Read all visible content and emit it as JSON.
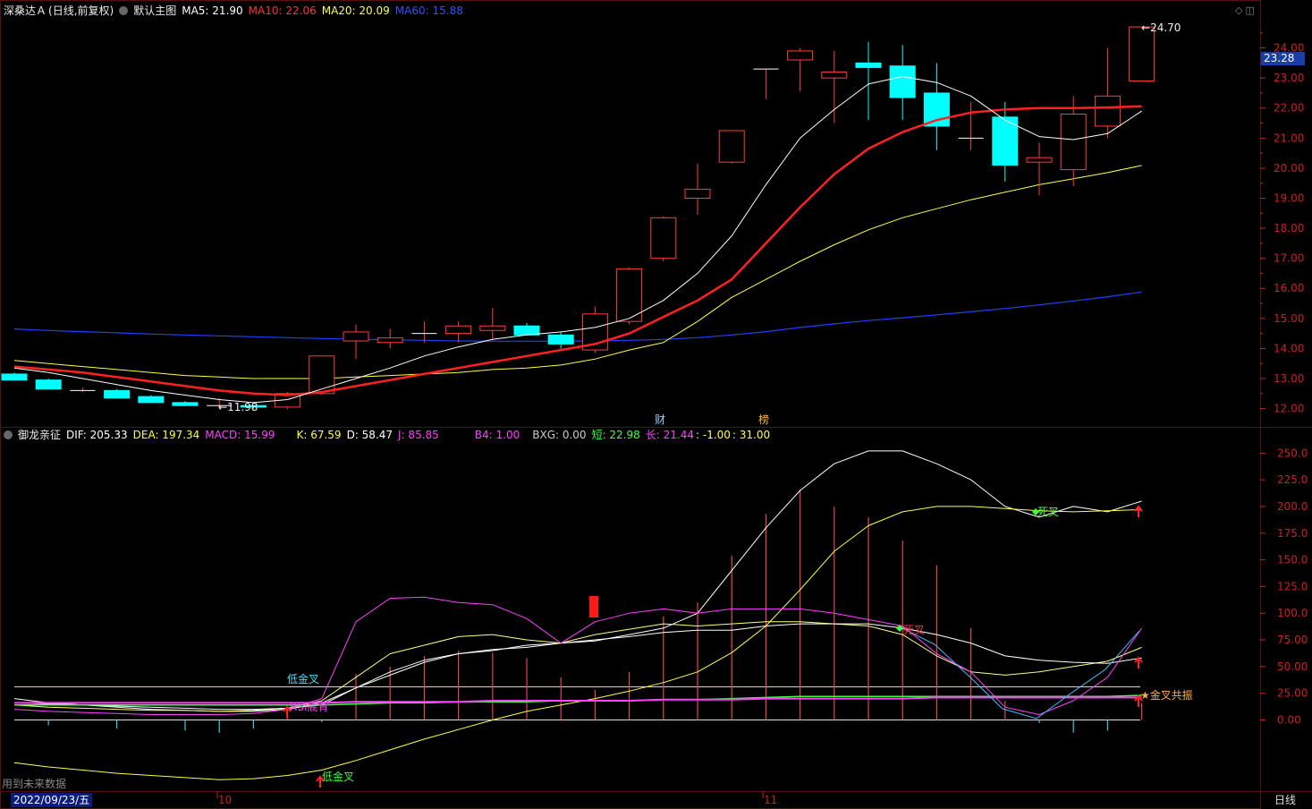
{
  "main_panel": {
    "stock_name": "深桑达Ａ",
    "mode": "(日线,前复权)",
    "indicator_name": "默认主图",
    "ma5": {
      "label": "MA5:",
      "value": "21.90",
      "color": "#ffffff"
    },
    "ma10": {
      "label": "MA10:",
      "value": "22.06",
      "color": "#ff3030"
    },
    "ma20": {
      "label": "MA20:",
      "value": "20.09",
      "color": "#ffff40"
    },
    "ma60": {
      "label": "MA60:",
      "value": "15.88",
      "color": "#3050ff"
    },
    "current_price_tag": "23.28",
    "high_annotation": "24.70",
    "low_annotation": "11.98",
    "event_marks": [
      "财",
      "榜"
    ]
  },
  "sub_panel": {
    "indicator_name": "御龙亲征",
    "readouts": [
      {
        "label": "DIF: 205.33",
        "color": "#ffffff"
      },
      {
        "label": "DEA: 197.34",
        "color": "#ffff40"
      },
      {
        "label": "MACD: 15.99",
        "color": "#ff40ff"
      },
      {
        "label": "K: 67.59",
        "color": "#ffff40"
      },
      {
        "label": "D: 58.47",
        "color": "#ffffff"
      },
      {
        "label": "J: 85.85",
        "color": "#ff40ff"
      },
      {
        "label": "B4: 1.00",
        "color": "#ff40ff"
      },
      {
        "label": "BXG: 0.00",
        "color": "#cccccc"
      },
      {
        "label": "短: 22.98",
        "color": "#40ff40"
      },
      {
        "label": "长: 21.44",
        "color": "#ff40ff"
      },
      {
        "label": ": -1.00",
        "color": "#ffff40"
      },
      {
        "label": ": 31.00",
        "color": "#ffff40"
      }
    ],
    "annotations": {
      "low_golden_cross_1": "低金叉",
      "rsi_label": "RSI底背",
      "low_golden_cross_2": "低金叉",
      "dead_cross_1": "死叉",
      "dead_cross_2": "死叉",
      "golden_cross_resonance": "金叉共振"
    }
  },
  "bottom_bar": {
    "date_box": "2022/09/23/五",
    "future_data_label": "用到未来数据",
    "month_labels": [
      "10",
      "11"
    ],
    "period_button": "日线"
  },
  "colors": {
    "up": "#ff3c3c",
    "down": "#00ffff",
    "ma5": "#ffffff",
    "ma10": "#ff2020",
    "ma20": "#ffff40",
    "ma60": "#2040ff",
    "grid": "#551111",
    "axis_text": "#cc2020"
  },
  "chart_data": [
    {
      "type": "candlestick",
      "title": "深桑达Ａ (日线,前复权)",
      "ylim": [
        11.6,
        25.0
      ],
      "y_ticks": [
        12.0,
        13.0,
        14.0,
        15.0,
        16.0,
        17.0,
        18.0,
        19.0,
        20.0,
        21.0,
        22.0,
        23.0,
        24.0
      ],
      "y_tick_labels": [
        "12.00",
        "13.00",
        "14.00",
        "15.00",
        "16.00",
        "17.00",
        "18.00",
        "19.00",
        "20.00",
        "21.00",
        "22.00",
        "23.00",
        "24.00"
      ],
      "ohlc": [
        [
          13.15,
          13.2,
          12.95,
          12.95
        ],
        [
          12.95,
          13.0,
          12.65,
          12.65
        ],
        [
          12.6,
          12.7,
          12.55,
          12.6
        ],
        [
          12.6,
          12.65,
          12.35,
          12.35
        ],
        [
          12.4,
          12.45,
          12.2,
          12.2
        ],
        [
          12.2,
          12.25,
          12.1,
          12.1
        ],
        [
          12.1,
          12.35,
          11.98,
          12.1
        ],
        [
          12.1,
          12.1,
          12.0,
          12.05
        ],
        [
          12.05,
          12.55,
          11.98,
          12.5
        ],
        [
          12.5,
          13.75,
          12.45,
          13.75
        ],
        [
          14.25,
          14.8,
          13.65,
          14.55
        ],
        [
          14.2,
          14.65,
          14.0,
          14.35
        ],
        [
          14.5,
          14.9,
          14.2,
          14.5
        ],
        [
          14.5,
          14.9,
          14.2,
          14.75
        ],
        [
          14.6,
          15.35,
          14.3,
          14.75
        ],
        [
          14.75,
          14.85,
          14.45,
          14.45
        ],
        [
          14.45,
          14.55,
          14.0,
          14.15
        ],
        [
          13.95,
          15.4,
          13.85,
          15.15
        ],
        [
          14.9,
          16.7,
          14.8,
          16.65
        ],
        [
          17.0,
          18.4,
          16.9,
          18.35
        ],
        [
          19.0,
          20.15,
          18.45,
          19.3
        ],
        [
          20.2,
          21.25,
          20.15,
          21.25
        ],
        [
          23.3,
          23.3,
          22.3,
          23.3
        ],
        [
          23.6,
          24.0,
          22.55,
          23.9
        ],
        [
          23.0,
          23.9,
          21.5,
          23.2
        ],
        [
          23.5,
          24.2,
          21.6,
          23.35
        ],
        [
          23.4,
          24.1,
          21.6,
          22.35
        ],
        [
          22.5,
          23.5,
          20.6,
          21.4
        ],
        [
          21.0,
          22.2,
          20.6,
          21.0
        ],
        [
          21.7,
          22.2,
          19.55,
          20.1
        ],
        [
          20.2,
          20.85,
          19.1,
          20.35
        ],
        [
          19.95,
          22.4,
          19.4,
          21.8
        ],
        [
          21.4,
          24.0,
          21.0,
          22.4
        ],
        [
          22.9,
          24.7,
          22.9,
          24.7
        ]
      ],
      "series": [
        {
          "name": "MA5",
          "values": [
            13.35,
            13.2,
            13.0,
            12.8,
            12.6,
            12.45,
            12.3,
            12.2,
            12.3,
            12.65,
            13.0,
            13.35,
            13.75,
            14.05,
            14.3,
            14.45,
            14.55,
            14.7,
            15.0,
            15.6,
            16.5,
            17.75,
            19.45,
            21.0,
            21.95,
            22.8,
            23.05,
            22.85,
            22.4,
            21.6,
            21.05,
            20.95,
            21.15,
            21.9
          ]
        },
        {
          "name": "MA10",
          "values": [
            13.4,
            13.3,
            13.2,
            13.05,
            12.9,
            12.75,
            12.6,
            12.5,
            12.45,
            12.55,
            12.75,
            12.95,
            13.15,
            13.35,
            13.55,
            13.75,
            13.95,
            14.15,
            14.5,
            15.05,
            15.6,
            16.3,
            17.5,
            18.7,
            19.8,
            20.65,
            21.2,
            21.6,
            21.85,
            21.95,
            22.0,
            22.0,
            22.02,
            22.06
          ]
        },
        {
          "name": "MA20",
          "values": [
            13.6,
            13.5,
            13.4,
            13.3,
            13.2,
            13.1,
            13.05,
            13.0,
            13.0,
            13.0,
            13.05,
            13.1,
            13.15,
            13.2,
            13.3,
            13.35,
            13.45,
            13.65,
            13.95,
            14.2,
            14.9,
            15.7,
            16.3,
            16.9,
            17.45,
            17.95,
            18.35,
            18.65,
            18.95,
            19.2,
            19.45,
            19.65,
            19.85,
            20.09
          ]
        },
        {
          "name": "MA60",
          "values": [
            14.65,
            14.6,
            14.56,
            14.52,
            14.48,
            14.45,
            14.42,
            14.39,
            14.36,
            14.33,
            14.31,
            14.29,
            14.27,
            14.25,
            14.24,
            14.24,
            14.24,
            14.25,
            14.27,
            14.3,
            14.36,
            14.45,
            14.56,
            14.7,
            14.82,
            14.93,
            15.02,
            15.12,
            15.22,
            15.33,
            15.45,
            15.58,
            15.72,
            15.88
          ]
        }
      ]
    },
    {
      "type": "line",
      "title": "御龙亲征",
      "ylim": [
        -65,
        262
      ],
      "y_ticks": [
        0,
        25,
        50,
        75,
        100,
        125,
        150,
        175,
        200,
        225,
        250
      ],
      "y_tick_labels": [
        "0.00",
        "25.00",
        "50.00",
        "75.00",
        "100.0",
        "125.0",
        "150.0",
        "175.0",
        "200.0",
        "225.0",
        "250.0"
      ],
      "x": [
        "09/23",
        "10",
        "11"
      ],
      "bars": [
        0,
        -5,
        0,
        -8,
        0,
        -10,
        -12,
        -8,
        4,
        -2,
        43,
        50,
        60,
        65,
        63,
        58,
        40,
        28,
        45,
        97,
        110,
        154,
        193,
        216,
        200,
        190,
        168,
        145,
        86,
        18,
        -3,
        -12,
        -10,
        16
      ],
      "series": [
        {
          "name": "DIF",
          "values": [
            20,
            16,
            14,
            12,
            10,
            9,
            8,
            8,
            10,
            16,
            30,
            45,
            56,
            62,
            65,
            70,
            72,
            74,
            80,
            86,
            100,
            140,
            180,
            215,
            240,
            252,
            252,
            240,
            225,
            200,
            190,
            200,
            195,
            205
          ]
        },
        {
          "name": "DEA",
          "values": [
            -40,
            -44,
            -47,
            -50,
            -52,
            -54,
            -56,
            -55,
            -52,
            -47,
            -38,
            -28,
            -18,
            -9,
            0,
            8,
            14,
            20,
            27,
            35,
            45,
            63,
            88,
            122,
            158,
            182,
            195,
            200,
            200,
            198,
            196,
            195,
            196,
            197
          ]
        },
        {
          "name": "K",
          "values": [
            14,
            12,
            11,
            10,
            9,
            9,
            8,
            9,
            11,
            18,
            40,
            62,
            70,
            78,
            80,
            75,
            72,
            80,
            85,
            90,
            88,
            90,
            92,
            92,
            90,
            88,
            80,
            60,
            45,
            42,
            45,
            50,
            55,
            68
          ]
        },
        {
          "name": "D",
          "values": [
            16,
            15,
            14,
            13,
            12,
            11,
            10,
            10,
            11,
            14,
            30,
            42,
            54,
            62,
            66,
            68,
            72,
            75,
            78,
            82,
            84,
            84,
            88,
            90,
            90,
            90,
            86,
            80,
            72,
            60,
            56,
            54,
            53,
            58
          ]
        },
        {
          "name": "J",
          "values": [
            10,
            8,
            7,
            6,
            5,
            5,
            5,
            6,
            10,
            20,
            92,
            114,
            115,
            110,
            108,
            95,
            72,
            92,
            100,
            104,
            100,
            104,
            104,
            104,
            100,
            94,
            88,
            62,
            45,
            12,
            5,
            18,
            40,
            86
          ]
        },
        {
          "name": "短",
          "values": [
            14,
            14,
            14,
            14,
            14,
            14,
            14,
            14,
            14,
            14,
            15,
            16,
            16,
            17,
            17,
            17,
            18,
            18,
            18,
            19,
            19,
            20,
            21,
            22,
            22,
            22,
            22,
            22,
            22,
            22,
            22,
            22,
            22,
            23
          ]
        },
        {
          "name": "长",
          "values": [
            16,
            16,
            16,
            16,
            16,
            16,
            16,
            16,
            16,
            16,
            17,
            17,
            17,
            17,
            18,
            18,
            18,
            18,
            18,
            19,
            19,
            19,
            20,
            20,
            20,
            20,
            20,
            21,
            21,
            21,
            21,
            21,
            21,
            21
          ]
        }
      ],
      "hlines": [
        31,
        0
      ]
    }
  ]
}
